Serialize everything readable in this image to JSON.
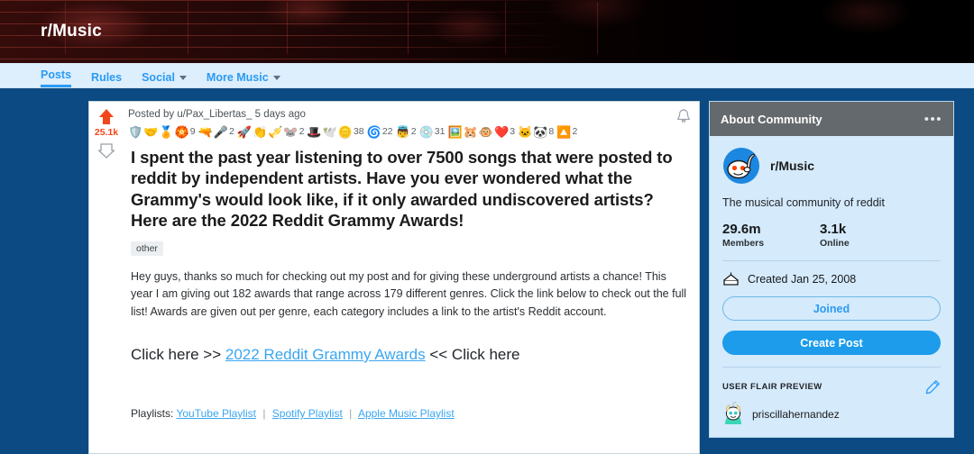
{
  "banner": {
    "title": "r/Music"
  },
  "nav": {
    "items": [
      {
        "label": "Posts",
        "active": true,
        "dropdown": false
      },
      {
        "label": "Rules",
        "active": false,
        "dropdown": false
      },
      {
        "label": "Social",
        "active": false,
        "dropdown": true
      },
      {
        "label": "More Music",
        "active": false,
        "dropdown": true
      }
    ]
  },
  "post": {
    "votes": "25.1k",
    "byline": "Posted by u/Pax_Libertas_ 5 days ago",
    "title": "I spent the past year listening to over 7500 songs that were posted to reddit by independent artists. Have you ever wondered what the Grammy's would look like, if it only awarded undiscovered artists? Here are the 2022 Reddit Grammy Awards!",
    "flair": "other",
    "body": "Hey guys, thanks so much for checking out my post and for giving these underground artists a chance! This year I am giving out 182 awards that range across 179 different genres. Click the link below to check out the full list! Awards are given out per genre, each category includes a link to the artist's Reddit account.",
    "click_prefix": "Click here >> ",
    "click_link": "2022 Reddit Grammy Awards",
    "click_suffix": " << Click here",
    "playlists_label": "Playlists:",
    "playlist_links": [
      "YouTube Playlist",
      "Spotify Playlist",
      "Apple Music Playlist"
    ],
    "awards": [
      {
        "icon": "helpful-award",
        "glyph": "🛡️",
        "count": ""
      },
      {
        "icon": "wholesome-award",
        "glyph": "🤝",
        "count": ""
      },
      {
        "icon": "gold-award",
        "glyph": "🏅",
        "count": ""
      },
      {
        "icon": "silver-award",
        "glyph": "🏵️",
        "count": "9"
      },
      {
        "icon": "rocket-like-award",
        "glyph": "🔫",
        "count": ""
      },
      {
        "icon": "bravo-award",
        "glyph": "🎤",
        "count": "2"
      },
      {
        "icon": "take-my-energy-award",
        "glyph": "🚀",
        "count": ""
      },
      {
        "icon": "starstruck-award",
        "glyph": "👏",
        "count": ""
      },
      {
        "icon": "masterpiece-award",
        "glyph": "🎺",
        "count": ""
      },
      {
        "icon": "bless-up-award",
        "glyph": "🐭",
        "count": "2"
      },
      {
        "icon": "hat-award",
        "glyph": "🎩",
        "count": ""
      },
      {
        "icon": "dove-award",
        "glyph": "🕊️",
        "count": ""
      },
      {
        "icon": "silver-coin-award",
        "glyph": "🪙",
        "count": "38"
      },
      {
        "icon": "snowflake-award",
        "glyph": "🌀",
        "count": "22"
      },
      {
        "icon": "wholesome-seal-award",
        "glyph": "👼",
        "count": "2"
      },
      {
        "icon": "snoo-silver-award",
        "glyph": "💿",
        "count": "31"
      },
      {
        "icon": "table-flip-award",
        "glyph": "🖼️",
        "count": ""
      },
      {
        "icon": "snoo-clap-award",
        "glyph": "🐹",
        "count": ""
      },
      {
        "icon": "snoo-excited-award",
        "glyph": "🐵",
        "count": ""
      },
      {
        "icon": "heartwarming-award",
        "glyph": "❤️",
        "count": "3"
      },
      {
        "icon": "cat-award",
        "glyph": "🐱",
        "count": ""
      },
      {
        "icon": "snoo-hug-award",
        "glyph": "🐼",
        "count": "8"
      },
      {
        "icon": "upvote-award",
        "glyph": "🔼",
        "count": "2"
      }
    ]
  },
  "sidebar": {
    "header": "About Community",
    "community_name": "r/Music",
    "description": "The musical community of reddit",
    "members_count": "29.6m",
    "members_label": "Members",
    "online_count": "3.1k",
    "online_label": "Online",
    "created": "Created Jan 25, 2008",
    "joined_button": "Joined",
    "create_post_button": "Create Post",
    "flair_preview_label": "USER FLAIR PREVIEW",
    "flair_username": "priscillahernandez"
  },
  "colors": {
    "page_bg": "#0b4a82",
    "nav_bg": "#ddeefc",
    "accent_blue": "#2a9bf4",
    "upvote_orange": "#f2461b",
    "card_header_gray": "#64696d",
    "sidebar_bg": "#d5eafb"
  }
}
